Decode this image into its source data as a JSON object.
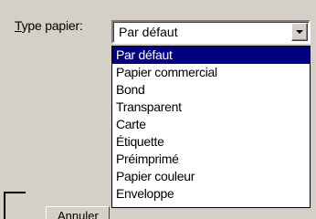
{
  "field": {
    "label": "Type papier:",
    "selected_value": "Par défaut"
  },
  "dropdown": {
    "items": [
      "Par défaut",
      "Papier commercial",
      "Bond",
      "Transparent",
      "Carte",
      "Étiquette",
      "Préimprimé",
      "Papier couleur",
      "Enveloppe"
    ],
    "selected_index": 0
  },
  "footer": {
    "cancel_label": "Annuler"
  },
  "icons": {
    "dropdown_arrow": "chevron-down-icon"
  }
}
